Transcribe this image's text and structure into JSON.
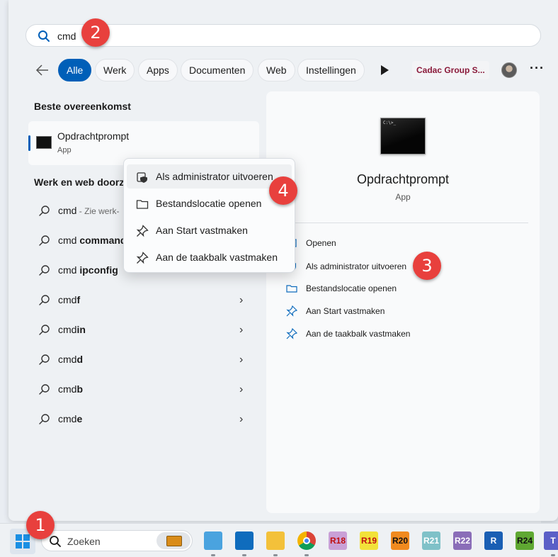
{
  "search": {
    "value": "cmd"
  },
  "filters": {
    "chips": [
      "Alle",
      "Werk",
      "Apps",
      "Documenten",
      "Web",
      "Instellingen"
    ],
    "active": "Alle",
    "org": "Cadac Group S..."
  },
  "left": {
    "best_match_heading": "Beste overeenkomst",
    "best_match": {
      "title": "Opdrachtprompt",
      "subtitle": "App"
    },
    "web_heading": "Werk en web doorzo",
    "results": [
      {
        "prefix": "cmd",
        "bold": "",
        "muted": " - Zie werk-",
        "chevron": false
      },
      {
        "prefix": "cmd ",
        "bold": "command",
        "muted": "",
        "chevron": false
      },
      {
        "prefix": "cmd ",
        "bold": "ipconfig",
        "muted": "",
        "chevron": false
      },
      {
        "prefix": "cmd",
        "bold": "f",
        "muted": "",
        "chevron": true
      },
      {
        "prefix": "cmd",
        "bold": "in",
        "muted": "",
        "chevron": true
      },
      {
        "prefix": "cmd",
        "bold": "d",
        "muted": "",
        "chevron": true
      },
      {
        "prefix": "cmd",
        "bold": "b",
        "muted": "",
        "chevron": true
      },
      {
        "prefix": "cmd",
        "bold": "e",
        "muted": "",
        "chevron": true
      }
    ]
  },
  "detail": {
    "title": "Opdrachtprompt",
    "subtitle": "App",
    "actions": [
      {
        "label": "Openen",
        "icon": "open-icon"
      },
      {
        "label": "Als administrator uitvoeren",
        "icon": "shield-icon"
      },
      {
        "label": "Bestandslocatie openen",
        "icon": "folder-icon"
      },
      {
        "label": "Aan Start vastmaken",
        "icon": "pin-icon"
      },
      {
        "label": "Aan de taakbalk vastmaken",
        "icon": "pin-icon"
      }
    ]
  },
  "context_menu": {
    "items": [
      {
        "label": "Als administrator uitvoeren",
        "icon": "shield-icon"
      },
      {
        "label": "Bestandslocatie openen",
        "icon": "folder-icon"
      },
      {
        "label": "Aan Start vastmaken",
        "icon": "pin-icon"
      },
      {
        "label": "Aan de taakbalk vastmaken",
        "icon": "pin-icon"
      }
    ]
  },
  "badges": [
    "1",
    "2",
    "3",
    "4"
  ],
  "taskbar": {
    "search_placeholder": "Zoeken",
    "apps": [
      {
        "label": "",
        "name": "control-panel-icon",
        "bg": "#4aa3df",
        "fg": "#ffffff"
      },
      {
        "label": "",
        "name": "outlook-icon",
        "bg": "#0f6cbd",
        "fg": "#ffffff"
      },
      {
        "label": "",
        "name": "file-explorer-icon",
        "bg": "#f3c13a",
        "fg": "#7a5a00"
      },
      {
        "label": "",
        "name": "chrome-icon",
        "bg": "#ffffff",
        "fg": "#000000"
      },
      {
        "label": "R18",
        "name": "revit-r18-icon",
        "bg": "#c9a0d6",
        "fg": "#c01010"
      },
      {
        "label": "R19",
        "name": "revit-r19-icon",
        "bg": "#f2e23a",
        "fg": "#c01010"
      },
      {
        "label": "R20",
        "name": "revit-r20-icon",
        "bg": "#f08a1e",
        "fg": "#111111"
      },
      {
        "label": "R21",
        "name": "revit-r21-icon",
        "bg": "#7fc1c8",
        "fg": "#ffffff"
      },
      {
        "label": "R22",
        "name": "revit-r22-icon",
        "bg": "#8a6db8",
        "fg": "#ffffff"
      },
      {
        "label": "R",
        "name": "revit-icon",
        "bg": "#1a5fb4",
        "fg": "#ffffff"
      },
      {
        "label": "R24",
        "name": "revit-r24-icon",
        "bg": "#5fa832",
        "fg": "#111111"
      },
      {
        "label": "T",
        "name": "teams-icon",
        "bg": "#5b5fc7",
        "fg": "#ffffff"
      }
    ]
  }
}
